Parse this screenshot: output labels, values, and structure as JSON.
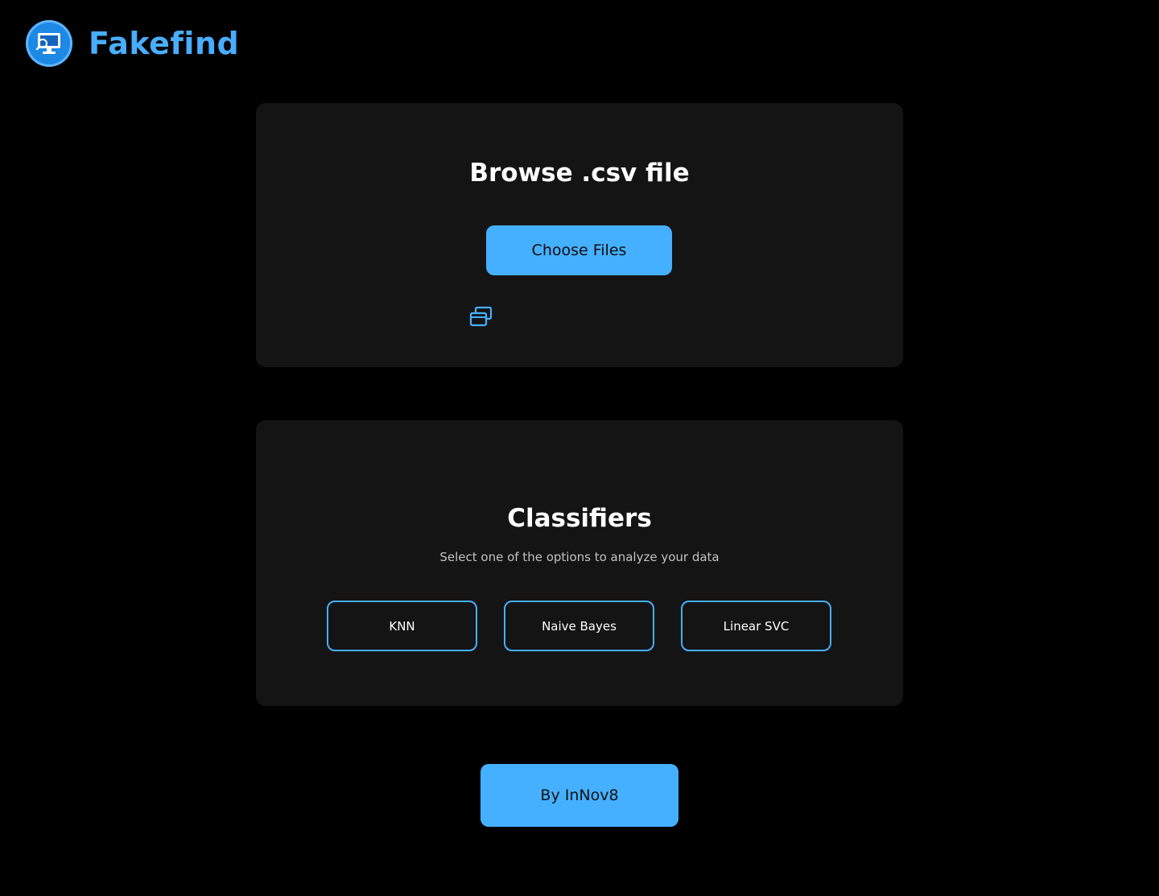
{
  "app": {
    "brand_name": "Fakefind",
    "logo_icon": "monitor-search-icon",
    "accent_color": "#45b0ff"
  },
  "upload_card": {
    "title": "Browse .csv file",
    "choose_button_label": "Choose Files",
    "file_icon": "stacked-windows-icon"
  },
  "classifiers_card": {
    "title": "Classifiers",
    "subtitle": "Select one of the options to analyze your data",
    "options": [
      "KNN",
      "Naive Bayes",
      "Linear SVC"
    ]
  },
  "footer": {
    "credit_label": "By InNov8"
  }
}
